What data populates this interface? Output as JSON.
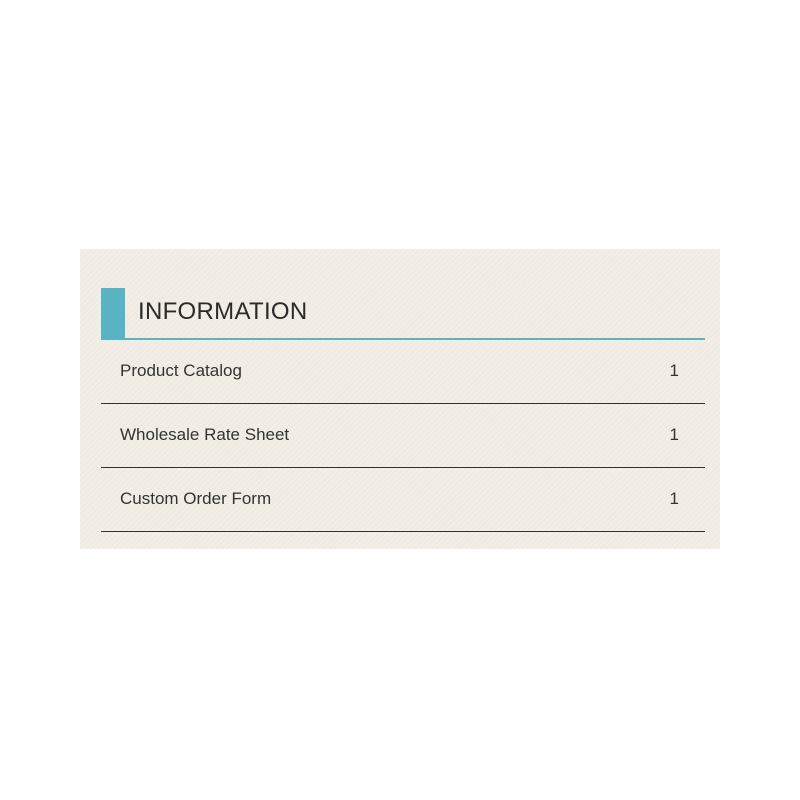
{
  "widget": {
    "title": "INFORMATION",
    "accent_color": "#58b4c2",
    "background_color": "#f1ede4",
    "items": [
      {
        "label": "Product Catalog",
        "count": "1"
      },
      {
        "label": "Wholesale Rate Sheet",
        "count": "1"
      },
      {
        "label": "Custom Order Form",
        "count": "1"
      }
    ]
  }
}
